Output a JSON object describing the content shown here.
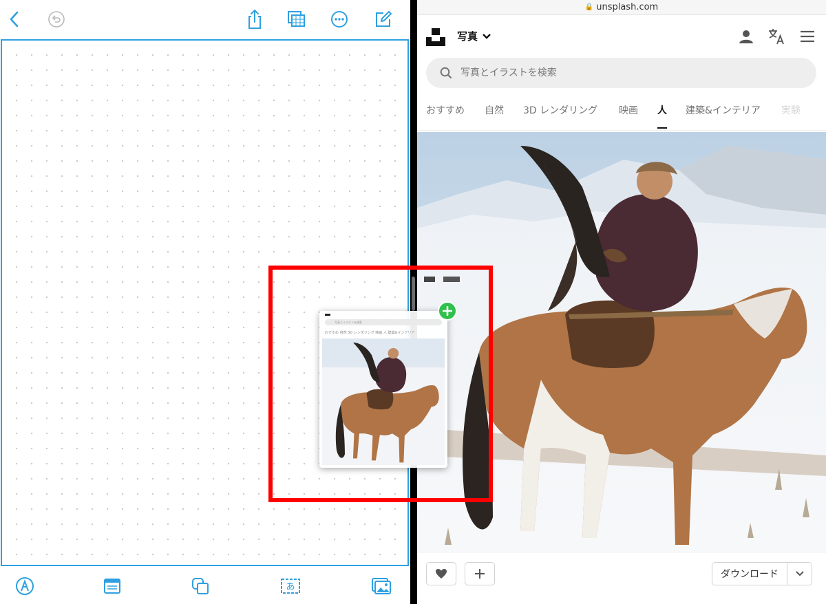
{
  "safari": {
    "url": "unsplash.com"
  },
  "unsplash": {
    "nav_photo_label": "写真",
    "search_placeholder": "写真とイラストを検索",
    "tabs": [
      {
        "label": "おすすめ"
      },
      {
        "label": "自然"
      },
      {
        "label": "3D レンダリング"
      },
      {
        "label": "映画"
      },
      {
        "label": "人"
      },
      {
        "label": "建築&インテリア"
      },
      {
        "label": "実験"
      }
    ],
    "active_tab": "人",
    "download_label": "ダウンロード"
  },
  "drag_preview": {
    "search_placeholder": "写真とイラストを検索",
    "tabs_text": "おすすめ  自然  3D レンダリング  映画  人  建築&インテリア"
  },
  "icons": {
    "freeform_top": [
      "back-chevron-icon",
      "undo-icon",
      "share-icon",
      "browse-boards-icon",
      "more-icon",
      "new-board-icon"
    ],
    "freeform_bottom": [
      "pen-icon",
      "sticky-note-icon",
      "shapes-icon",
      "text-box-icon",
      "media-icon"
    ],
    "unsplash": [
      "unsplash-logo-icon",
      "chevron-down-icon",
      "user-icon",
      "translate-icon",
      "menu-icon",
      "search-icon",
      "heart-icon",
      "plus-icon",
      "chevron-down-icon"
    ]
  },
  "colors": {
    "freeform_accent": "#2ea0e0",
    "highlight": "#ff0000",
    "add_badge": "#30c04c"
  }
}
